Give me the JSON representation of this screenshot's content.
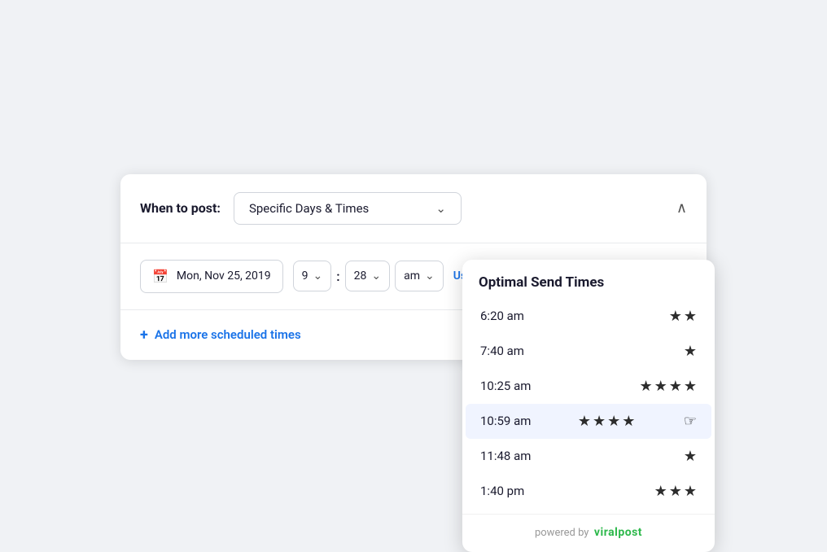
{
  "header": {
    "when_label": "When to post:",
    "dropdown_value": "Specific Days & Times",
    "collapse_icon": "∧"
  },
  "schedule": {
    "date_value": "Mon, Nov 25, 2019",
    "hour_value": "9",
    "minute_value": "28",
    "ampm_value": "am",
    "use_optimal_label": "Use Optimal Times"
  },
  "add_more": {
    "label": "Add more scheduled times"
  },
  "optimal_dropdown": {
    "title": "Optimal Send Times",
    "items": [
      {
        "time": "6:20 am",
        "stars": 2
      },
      {
        "time": "7:40 am",
        "stars": 1
      },
      {
        "time": "10:25 am",
        "stars": 4
      },
      {
        "time": "10:59 am",
        "stars": 4,
        "active": true
      },
      {
        "time": "11:48 am",
        "stars": 1
      },
      {
        "time": "1:40 pm",
        "stars": 3
      }
    ],
    "powered_by_prefix": "powered by",
    "brand_name": "viralpost"
  }
}
